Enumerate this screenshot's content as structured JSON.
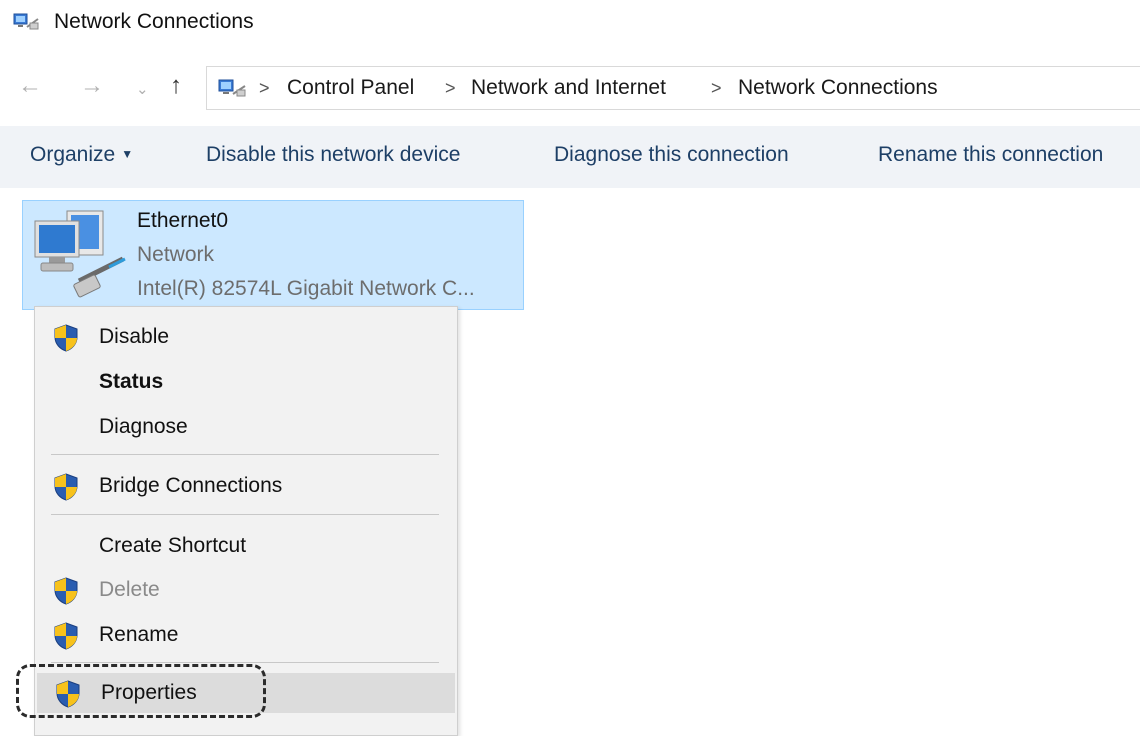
{
  "window": {
    "title": "Network Connections",
    "icon": "network-connections-icon"
  },
  "nav": {
    "back": "←",
    "forward": "→",
    "recent": "⌄",
    "up": "↑"
  },
  "breadcrumb": {
    "separator": ">",
    "items": [
      "Control Panel",
      "Network and Internet",
      "Network Connections"
    ]
  },
  "toolbar": {
    "organize": "Organize",
    "disable": "Disable this network device",
    "diagnose": "Diagnose this connection",
    "rename": "Rename this connection"
  },
  "connection": {
    "name": "Ethernet0",
    "type": "Network",
    "device": "Intel(R) 82574L Gigabit Network C..."
  },
  "context_menu": {
    "items": [
      {
        "label": "Disable",
        "shield": true
      },
      {
        "label": "Status",
        "shield": false,
        "bold": true
      },
      {
        "label": "Diagnose",
        "shield": false
      },
      {
        "label": "Bridge Connections",
        "shield": true
      },
      {
        "label": "Create Shortcut",
        "shield": false
      },
      {
        "label": "Delete",
        "shield": true,
        "disabled": true
      },
      {
        "label": "Rename",
        "shield": true
      },
      {
        "label": "Properties",
        "shield": true,
        "hover": true
      }
    ]
  },
  "colors": {
    "selection_bg": "#cce8ff",
    "toolbar_text": "#1d3f66",
    "shield_blue": "#2a5db0",
    "shield_yellow": "#f7c21c"
  }
}
